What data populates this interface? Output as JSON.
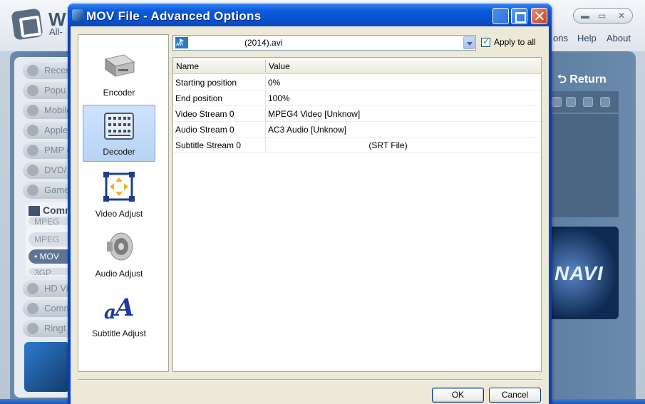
{
  "background_app": {
    "title": "W",
    "subtitle": "All-",
    "menu": [
      "ons",
      "Help",
      "About"
    ],
    "return_label": "Return",
    "sidebar": [
      "Recen",
      "Popu",
      "Mobile",
      "Apple",
      "PMP (",
      "DVD/",
      "Game",
      "Comm",
      "HD Vi",
      "Comm",
      "Ringt"
    ],
    "sidebar_sub": [
      "MPEG",
      "MPEG",
      "• MOV",
      "3GP"
    ],
    "navi_text": "NAVI"
  },
  "dialog": {
    "title": "MOV File - Advanced Options",
    "nav": [
      {
        "label": "Encoder",
        "selected": false
      },
      {
        "label": "Decoder",
        "selected": true
      },
      {
        "label": "Video Adjust",
        "selected": false
      },
      {
        "label": "Audio Adjust",
        "selected": false
      },
      {
        "label": "Subtitle Adjust",
        "selected": false
      }
    ],
    "file_select": {
      "value": "(2014).avi",
      "icon": "avi-file-icon"
    },
    "apply_all": {
      "label": "Apply to all",
      "checked": true
    },
    "table": {
      "headers": [
        "Name",
        "Value"
      ],
      "rows": [
        {
          "name": "Starting position",
          "value": "0%"
        },
        {
          "name": "End position",
          "value": "100%"
        },
        {
          "name": "Video Stream 0",
          "value": "MPEG4 Video [Unknow]"
        },
        {
          "name": "Audio Stream 0",
          "value": "AC3 Audio [Unknow]"
        },
        {
          "name": "Subtitle Stream 0",
          "value": "(SRT File)"
        }
      ]
    },
    "buttons": {
      "ok": "OK",
      "cancel": "Cancel"
    }
  },
  "colors": {
    "titlebar": "#0852d0",
    "dialog_bg": "#ece9d8",
    "selection": "#b6d3f5"
  }
}
